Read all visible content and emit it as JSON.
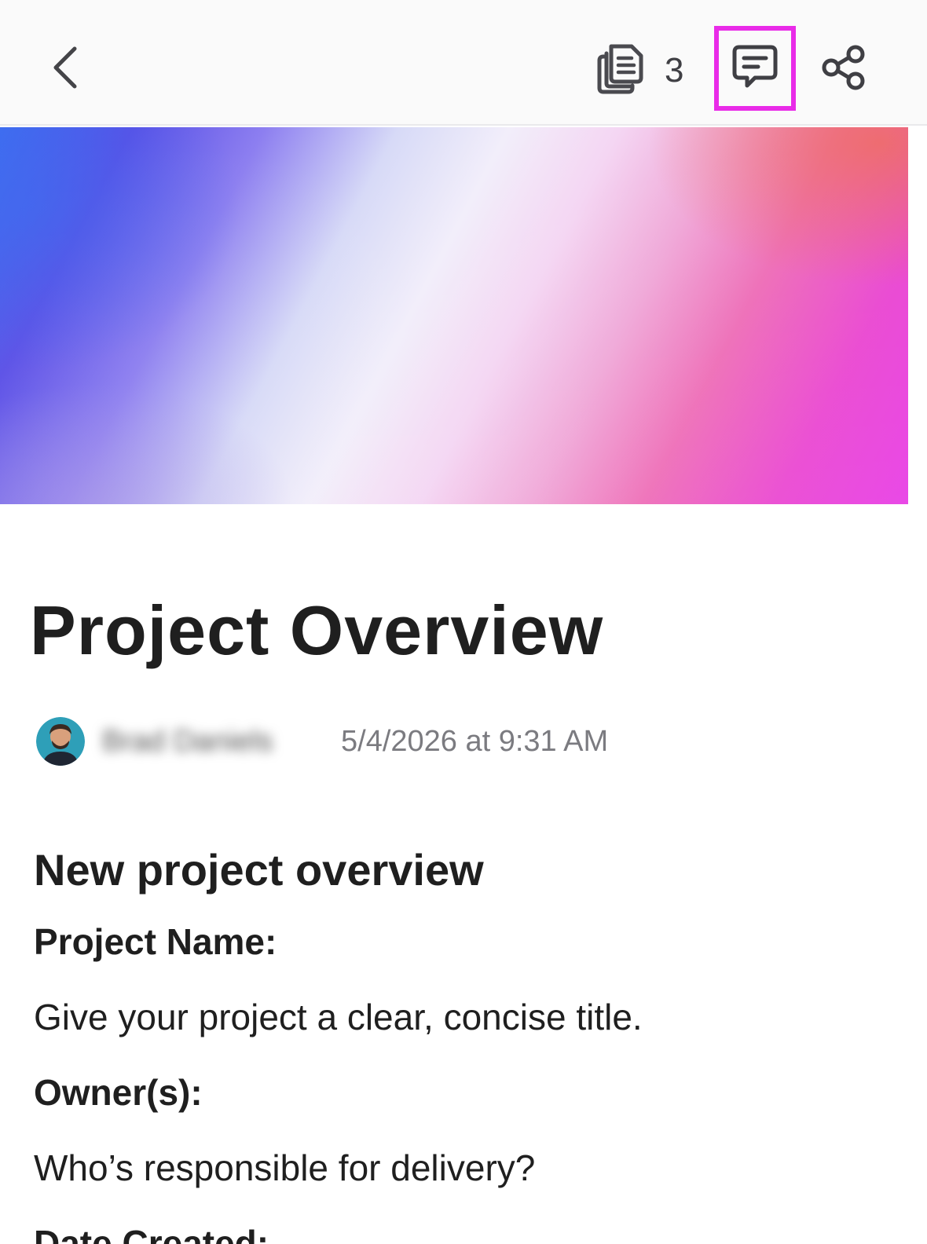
{
  "toolbar": {
    "back_icon": "chevron-left-icon",
    "pages_icon": "document-stack-icon",
    "pages_count": "3",
    "comments_icon": "comment-bubble-icon",
    "share_icon": "share-icon",
    "highlight_color": "#e92be8"
  },
  "cover": {
    "colors": [
      "#3e6df0",
      "#5a4fe6",
      "#f2eefa",
      "#ee6fb8",
      "#e83fe6"
    ]
  },
  "document": {
    "title": "Project Overview",
    "author": "Brad Daniels",
    "timestamp": "5/4/2026 at 9:31 AM",
    "heading": "New project overview",
    "fields": [
      {
        "label": "Project Name:",
        "value": "Give your project a clear, concise title."
      },
      {
        "label": "Owner(s):",
        "value": "Who’s responsible for delivery?"
      },
      {
        "label": "Date Created:"
      }
    ]
  }
}
